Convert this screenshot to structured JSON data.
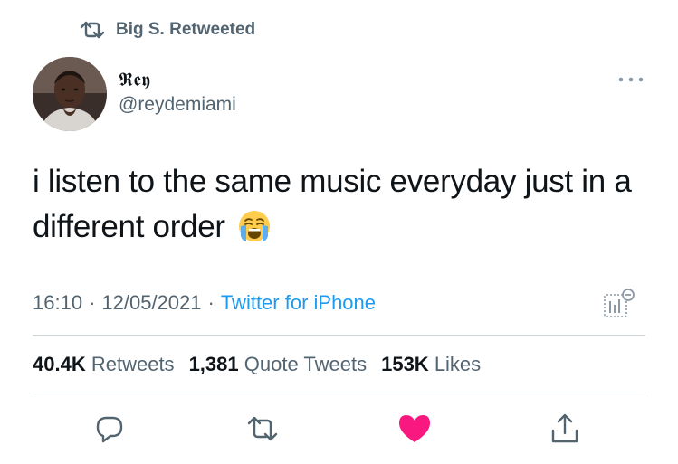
{
  "retweet_context": {
    "text": "Big S. Retweeted",
    "icon": "retweet-icon"
  },
  "author": {
    "display_name": "𝕽𝖊𝖞",
    "handle": "@reydemiami",
    "avatar": "profile-photo"
  },
  "tweet": {
    "text_line1": "i listen to the same music everyday just in a",
    "text_line2": "different order",
    "emoji": "loudly-crying-face"
  },
  "meta": {
    "time": "16:10",
    "separator": "·",
    "date": "12/05/2021",
    "source": "Twitter for iPhone"
  },
  "stats": {
    "retweets_count": "40.4K",
    "retweets_label": "Retweets",
    "quotes_count": "1,381",
    "quotes_label": "Quote Tweets",
    "likes_count": "153K",
    "likes_label": "Likes"
  },
  "actions": [
    "reply-icon",
    "retweet-icon",
    "like-icon",
    "share-icon"
  ],
  "colors": {
    "accent": "#1d9bf0",
    "muted": "#536471",
    "like": "#f91880",
    "text": "#0f1419"
  }
}
